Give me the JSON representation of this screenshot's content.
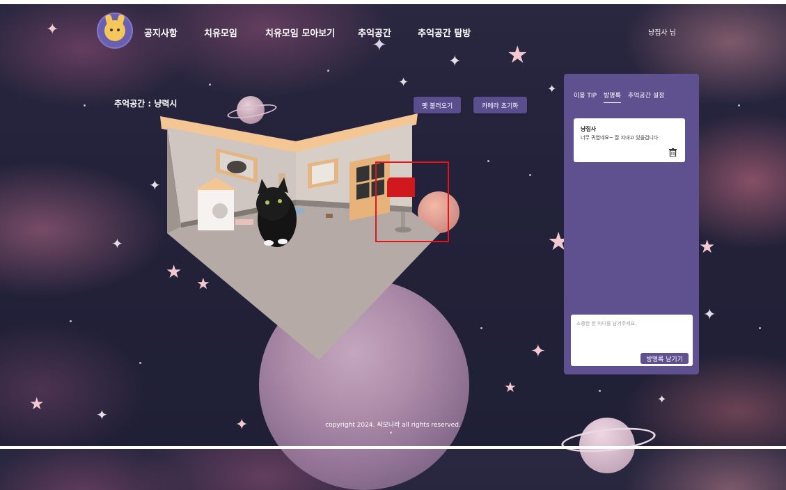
{
  "nav": {
    "items": [
      "공지사항",
      "치유모임",
      "치유모임 모아보기",
      "추억공간",
      "추억공간 탐방"
    ],
    "user": "냥집사 님"
  },
  "room": {
    "title": "추억공간 : 냥력시",
    "pet_button": "펫 불러오기",
    "camera_button": "카메라 초기화"
  },
  "panel": {
    "tabs": [
      "이용 TIP",
      "방명록",
      "추억공간 설정"
    ],
    "active_tab": "방명록",
    "entries": [
      {
        "author": "냥집사",
        "text": "너무 귀엽네요~ 잘 지내고 있을겁니다"
      }
    ],
    "input_placeholder": "소중한 한 마디를 남겨주세요.",
    "submit_label": "방명록 남기기"
  },
  "footer": {
    "copyright": "copyright 2024. 싸모나라 all rights reserved."
  },
  "colors": {
    "panel_bg": "#5f508f",
    "button_bg": "#5b4e8e",
    "highlight_box": "#e1141c",
    "room_floor": "#b5aaa5",
    "mailbox": "#d1181f"
  }
}
